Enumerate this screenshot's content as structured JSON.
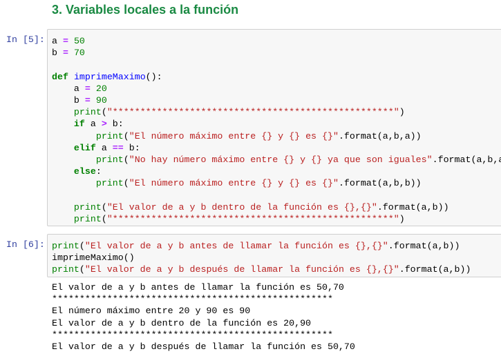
{
  "heading": "3. Variables locales a la función",
  "cells": [
    {
      "prompt": "In [5]:",
      "lines": [
        [
          [
            "p",
            "a "
          ],
          [
            "op",
            "="
          ],
          [
            "p",
            " "
          ],
          [
            "num",
            "50"
          ]
        ],
        [
          [
            "p",
            "b "
          ],
          [
            "op",
            "="
          ],
          [
            "p",
            " "
          ],
          [
            "num",
            "70"
          ]
        ],
        [],
        [
          [
            "kw",
            "def"
          ],
          [
            "p",
            " "
          ],
          [
            "fn",
            "imprimeMaximo"
          ],
          [
            "p",
            "():"
          ]
        ],
        [
          [
            "p",
            "    a "
          ],
          [
            "op",
            "="
          ],
          [
            "p",
            " "
          ],
          [
            "num",
            "20"
          ]
        ],
        [
          [
            "p",
            "    b "
          ],
          [
            "op",
            "="
          ],
          [
            "p",
            " "
          ],
          [
            "num",
            "90"
          ]
        ],
        [
          [
            "p",
            "    "
          ],
          [
            "bi",
            "print"
          ],
          [
            "p",
            "("
          ],
          [
            "str",
            "\"***************************************************\""
          ],
          [
            "p",
            ")"
          ]
        ],
        [
          [
            "p",
            "    "
          ],
          [
            "kw",
            "if"
          ],
          [
            "p",
            " a "
          ],
          [
            "op",
            ">"
          ],
          [
            "p",
            " b:"
          ]
        ],
        [
          [
            "p",
            "        "
          ],
          [
            "bi",
            "print"
          ],
          [
            "p",
            "("
          ],
          [
            "str",
            "\"El número máximo entre {} y {} es {}\""
          ],
          [
            "p",
            ".format(a,b,a))"
          ]
        ],
        [
          [
            "p",
            "    "
          ],
          [
            "kw",
            "elif"
          ],
          [
            "p",
            " a "
          ],
          [
            "op",
            "=="
          ],
          [
            "p",
            " b:"
          ]
        ],
        [
          [
            "p",
            "        "
          ],
          [
            "bi",
            "print"
          ],
          [
            "p",
            "("
          ],
          [
            "str",
            "\"No hay número máximo entre {} y {} ya que son iguales\""
          ],
          [
            "p",
            ".format(a,b,a))"
          ]
        ],
        [
          [
            "p",
            "    "
          ],
          [
            "kw",
            "else"
          ],
          [
            "p",
            ":"
          ]
        ],
        [
          [
            "p",
            "        "
          ],
          [
            "bi",
            "print"
          ],
          [
            "p",
            "("
          ],
          [
            "str",
            "\"El número máximo entre {} y {} es {}\""
          ],
          [
            "p",
            ".format(a,b,b))"
          ]
        ],
        [],
        [
          [
            "p",
            "    "
          ],
          [
            "bi",
            "print"
          ],
          [
            "p",
            "("
          ],
          [
            "str",
            "\"El valor de a y b dentro de la función es {},{}\""
          ],
          [
            "p",
            ".format(a,b))"
          ]
        ],
        [
          [
            "p",
            "    "
          ],
          [
            "bi",
            "print"
          ],
          [
            "p",
            "("
          ],
          [
            "str",
            "\"***************************************************\""
          ],
          [
            "p",
            ")"
          ]
        ]
      ]
    },
    {
      "prompt": "In [6]:",
      "lines": [
        [
          [
            "bi",
            "print"
          ],
          [
            "p",
            "("
          ],
          [
            "str",
            "\"El valor de a y b antes de llamar la función es {},{}\""
          ],
          [
            "p",
            ".format(a,b))"
          ]
        ],
        [
          [
            "p",
            "imprimeMaximo()"
          ]
        ],
        [
          [
            "bi",
            "print"
          ],
          [
            "p",
            "("
          ],
          [
            "str",
            "\"El valor de a y b después de llamar la función es {},{}\""
          ],
          [
            "p",
            ".format(a,b))"
          ]
        ]
      ]
    }
  ],
  "output": [
    "El valor de a y b antes de llamar la función es 50,70",
    "***************************************************",
    "El número máximo entre 20 y 90 es 90",
    "El valor de a y b dentro de la función es 20,90",
    "***************************************************",
    "El valor de a y b después de llamar la función es 50,70"
  ]
}
